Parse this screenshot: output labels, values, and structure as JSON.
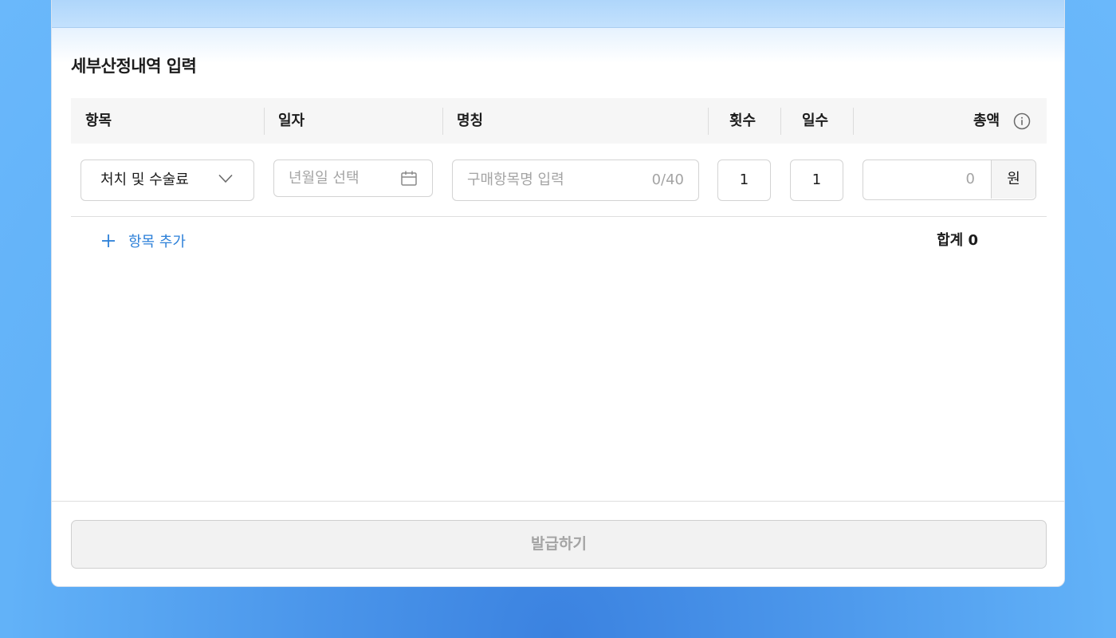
{
  "section": {
    "title": "세부산정내역 입력"
  },
  "table": {
    "headers": {
      "item": "항목",
      "date": "일자",
      "name": "명칭",
      "count": "횟수",
      "days": "일수",
      "total": "총액"
    }
  },
  "row": {
    "category_value": "처치 및 수술료",
    "date_placeholder": "년월일 선택",
    "name_placeholder": "구매항목명 입력",
    "name_counter": "0/40",
    "count_value": "1",
    "days_value": "1",
    "amount_value": "0",
    "amount_unit": "원"
  },
  "actions": {
    "add_item_label": "항목 추가",
    "sum_label": "합계 0",
    "issue_button_label": "발급하기"
  },
  "icons": {
    "dropdown": "chevron-down-icon",
    "calendar": "calendar-icon",
    "info": "info-icon",
    "add": "plus-icon"
  },
  "colors": {
    "accent": "#2b7fd8",
    "background_gradient_center": "#3b82e0",
    "background_gradient_edge": "#6ab8fb"
  }
}
